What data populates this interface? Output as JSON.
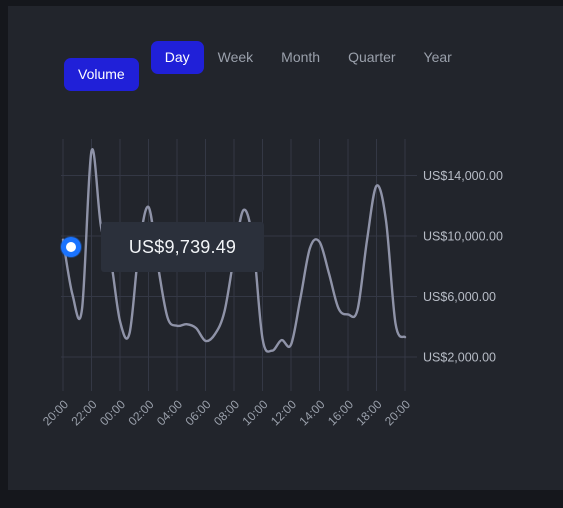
{
  "panel": {
    "background": "#22252c",
    "page_background": "#15171c",
    "accent": "#2020d8",
    "marker_color": "#1a73ff",
    "line_color": "#8f93a8"
  },
  "controls": {
    "volume_button": "Volume",
    "ranges": [
      {
        "label": "Day",
        "active": true
      },
      {
        "label": "Week",
        "active": false
      },
      {
        "label": "Month",
        "active": false
      },
      {
        "label": "Quarter",
        "active": false
      },
      {
        "label": "Year",
        "active": false
      }
    ]
  },
  "tooltip": {
    "value_label": "US$9,739.49"
  },
  "chart_data": {
    "type": "line",
    "title": "",
    "xlabel": "",
    "ylabel": "",
    "grid": true,
    "legend": false,
    "currency_prefix": "US$",
    "ylim": [
      0,
      16000
    ],
    "yticks": [
      14000,
      10000,
      6000,
      2000
    ],
    "ytick_labels": [
      "US$14,000.00",
      "US$10,000.00",
      "US$6,000.00",
      "US$2,000.00"
    ],
    "xtick_labels": [
      "20:00",
      "22:00",
      "00:00",
      "02:00",
      "04:00",
      "06:00",
      "08:00",
      "10:00",
      "12:00",
      "14:00",
      "16:00",
      "18:00",
      "20:00"
    ],
    "highlighted_point": {
      "x": "20:00",
      "y": 9739.49,
      "label": "US$9,739.49"
    },
    "series": [
      {
        "name": "Volume",
        "color": "#8f93a8",
        "x": [
          "20:00",
          "20:40",
          "21:20",
          "22:00",
          "22:40",
          "23:20",
          "00:00",
          "00:40",
          "01:20",
          "02:00",
          "02:40",
          "03:20",
          "04:00",
          "04:40",
          "05:20",
          "06:00",
          "06:40",
          "07:20",
          "08:00",
          "08:40",
          "09:20",
          "10:00",
          "10:40",
          "11:20",
          "12:00",
          "12:40",
          "13:20",
          "14:00",
          "14:40",
          "15:20",
          "16:00",
          "16:40",
          "17:20",
          "18:00",
          "18:40",
          "19:20",
          "20:00"
        ],
        "values": [
          9740,
          6100,
          5150,
          15600,
          10600,
          8500,
          4350,
          3550,
          9200,
          11900,
          8000,
          4600,
          4050,
          4150,
          3900,
          3050,
          3500,
          5000,
          8600,
          11700,
          9600,
          3200,
          2400,
          3100,
          2800,
          5900,
          9200,
          9600,
          7500,
          5200,
          4800,
          5100,
          9700,
          13300,
          11000,
          4200,
          3300
        ]
      }
    ]
  }
}
